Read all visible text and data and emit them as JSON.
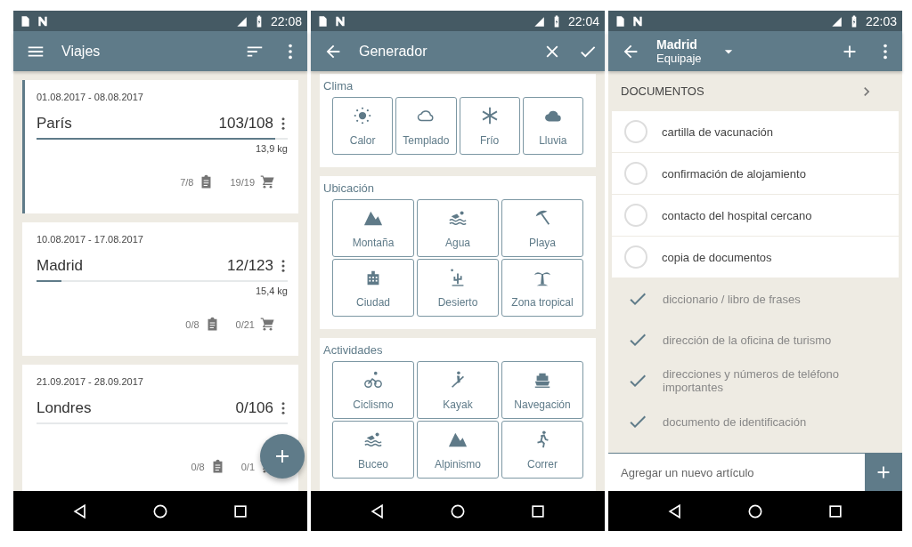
{
  "screens": [
    {
      "kind": "trips",
      "status_bar": {
        "time": "22:08"
      },
      "app_bar": {
        "title": "Viajes"
      },
      "trips": [
        {
          "dates": "01.08.2017 - 08.08.2017",
          "name": "París",
          "count": "103/108",
          "level": 0.95,
          "weight": "13,9 kg",
          "lists": "7/8",
          "shopping": "19/19",
          "selected": true
        },
        {
          "dates": "10.08.2017 - 17.08.2017",
          "name": "Madrid",
          "count": "12/123",
          "level": 0.1,
          "weight": "15,4 kg",
          "lists": "0/8",
          "shopping": "0/21",
          "selected": false
        },
        {
          "dates": "21.09.2017 - 28.09.2017",
          "name": "Londres",
          "count": "0/106",
          "level": 0,
          "lists": "0/8",
          "shopping": "0/1",
          "selected": false
        }
      ]
    },
    {
      "kind": "generator",
      "status_bar": {
        "time": "22:04"
      },
      "app_bar": {
        "title": "Generador"
      },
      "sections": [
        {
          "title": "Clima",
          "options": [
            "Calor",
            "Templado",
            "Frío",
            "Lluvia"
          ]
        },
        {
          "title": "Ubicación",
          "options": [
            "Montaña",
            "Agua",
            "Playa",
            "Ciudad",
            "Desierto",
            "Zona tropical"
          ]
        },
        {
          "title": "Actividades",
          "options": [
            "Ciclismo",
            "Kayak",
            "Navegación",
            "Buceo",
            "Alpinismo",
            "Correr"
          ]
        }
      ]
    },
    {
      "kind": "packing",
      "status_bar": {
        "time": "22:03"
      },
      "app_bar": {
        "title": "Madrid",
        "subtitle": "Equipaje"
      },
      "category": "DOCUMENTOS",
      "items": [
        {
          "label": "cartilla de vacunación",
          "checked": false
        },
        {
          "label": "confirmación de alojamiento",
          "checked": false
        },
        {
          "label": "contacto del hospital cercano",
          "checked": false
        },
        {
          "label": "copia de documentos",
          "checked": false
        },
        {
          "label": "diccionario / libro de frases",
          "checked": true
        },
        {
          "label": "dirección de la oficina de turismo",
          "checked": true
        },
        {
          "label": "direcciones y números de teléfono importantes",
          "checked": true
        },
        {
          "label": "documento de identificación",
          "checked": true
        }
      ],
      "new_item": {
        "placeholder": "Agregar un nuevo artículo"
      }
    }
  ]
}
